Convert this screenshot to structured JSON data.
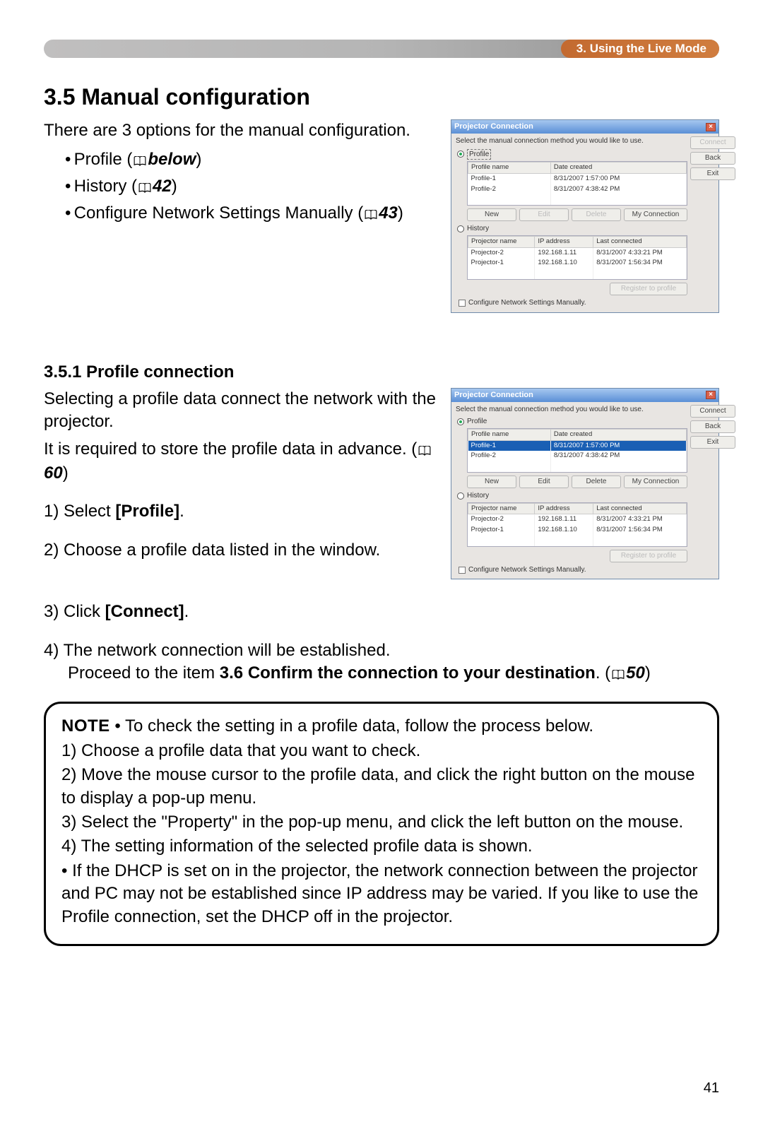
{
  "header": {
    "breadcrumb": "3. Using the Live Mode"
  },
  "section": {
    "title": "3.5 Manual configuration",
    "intro": "There are 3 options for the manual configuration.",
    "bullets": [
      {
        "label": "Profile",
        "refText": "below"
      },
      {
        "label": "History",
        "refText": "42"
      },
      {
        "label": "Configure Network Settings Manually",
        "refText": "43"
      }
    ]
  },
  "subsection": {
    "title": "3.5.1 Profile connection",
    "p1": "Selecting a profile data connect the network with the projector.",
    "p2a": "It is required to store the profile data in advance. (",
    "p2ref": "60",
    "p2b": ")",
    "step1a": "1) Select ",
    "step1b": "[Profile]",
    "step1c": ".",
    "step2": "2) Choose a profile data listed in the window.",
    "step3a": "3) Click ",
    "step3b": "[Connect]",
    "step3c": ".",
    "step4a": "4) The network connection will be established.",
    "step4b": "Proceed to the item ",
    "step4bold": "3.6 Confirm the connection to your destination",
    "step4c": ". (",
    "step4ref": "50",
    "step4d": ")"
  },
  "note": {
    "label": "NOTE",
    "lead": "  • To check the setting in a profile data, follow the process below.",
    "l1": "1) Choose a profile data that you want to check.",
    "l2": "2) Move the mouse cursor to the profile data, and click the right button on the mouse to display a pop-up menu.",
    "l3": "3) Select the \"Property\" in the pop-up menu, and click the left button on the mouse.",
    "l4": "4) The setting information of the selected profile data is shown.",
    "l5": "• If the DHCP is set on in the projector, the network connection between the projector and PC may not be established since IP address may be varied. If you like to use the Profile connection, set the DHCP off in the projector."
  },
  "dialog": {
    "title": "Projector Connection",
    "instruction": "Select the manual connection method you would like to use.",
    "radioProfile": "Profile",
    "radioHistory": "History",
    "profileHeaders": [
      "Profile name",
      "Date created"
    ],
    "profileRows": [
      {
        "name": "Profile-1",
        "date": "8/31/2007 1:57:00 PM"
      },
      {
        "name": "Profile-2",
        "date": "8/31/2007 4:38:42 PM"
      }
    ],
    "profBtns": {
      "new": "New",
      "edit": "Edit",
      "delete": "Delete",
      "my": "My Connection"
    },
    "historyHeaders": [
      "Projector name",
      "IP address",
      "Last connected"
    ],
    "historyRows": [
      {
        "name": "Projector-2",
        "ip": "192.168.1.11",
        "last": "8/31/2007 4:33:21 PM"
      },
      {
        "name": "Projector-1",
        "ip": "192.168.1.10",
        "last": "8/31/2007 1:56:34 PM"
      }
    ],
    "register": "Register to profile",
    "manual": "Configure Network Settings Manually.",
    "sideBtns": {
      "connect": "Connect",
      "back": "Back",
      "exit": "Exit"
    }
  },
  "pageNumber": "41"
}
